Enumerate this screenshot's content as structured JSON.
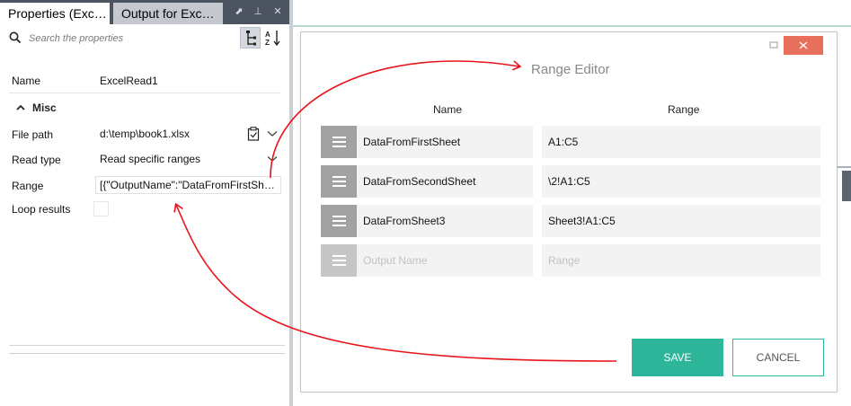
{
  "tabs": {
    "properties_label": "Properties (Exc…",
    "output_label": "Output for Exc…"
  },
  "search": {
    "placeholder": "Search the properties"
  },
  "properties": {
    "name_label": "Name",
    "name_value": "ExcelRead1",
    "misc_label": "Misc",
    "file_path_label": "File path",
    "file_path_value": "d:\\temp\\book1.xlsx",
    "read_type_label": "Read type",
    "read_type_value": "Read specific ranges",
    "range_label": "Range",
    "range_value": "[{\"OutputName\":\"DataFromFirstSh…",
    "loop_results_label": "Loop results",
    "loop_results_checked": false
  },
  "dialog": {
    "title": "Range Editor",
    "col_name": "Name",
    "col_range": "Range",
    "rows": [
      {
        "name": "DataFromFirstSheet",
        "range": "A1:C5"
      },
      {
        "name": "DataFromSecondSheet",
        "range": "\\2!A1:C5"
      },
      {
        "name": "DataFromSheet3",
        "range": "Sheet3!A1:C5"
      }
    ],
    "new_row": {
      "name_placeholder": "Output Name",
      "range_placeholder": "Range"
    },
    "save_label": "SAVE",
    "cancel_label": "CANCEL"
  },
  "colors": {
    "accent": "#2eb69a",
    "close_button": "#e86f5c",
    "tabbar": "#4c5461",
    "annotation_arrow": "#e8141b"
  },
  "icons": [
    "search-icon",
    "tree-sort-icon",
    "alpha-sort-icon",
    "clipboard-icon",
    "chevron-down-icon",
    "maximize-icon",
    "close-icon",
    "drag-handle-icon",
    "pin-icon",
    "float-icon",
    "tab-close-icon"
  ]
}
